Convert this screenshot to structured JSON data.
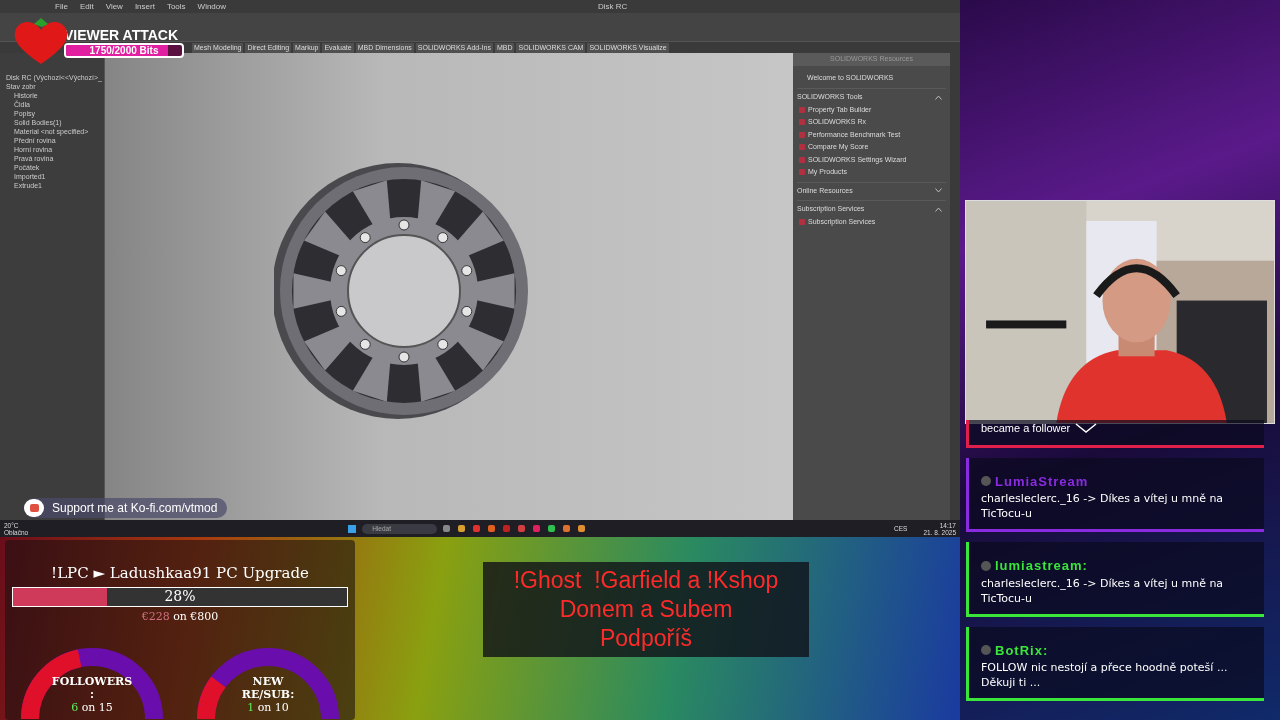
{
  "cad_window": {
    "title": "Disk RC",
    "menu": [
      "File",
      "Edit",
      "View",
      "Insert",
      "Tools",
      "Window"
    ],
    "tabs": [
      "Mesh Modeling",
      "Direct Editing",
      "Markup",
      "Evaluate",
      "MBD Dimensions",
      "SOLIDWORKS Add-Ins",
      "MBD",
      "SOLIDWORKS CAM",
      "SOLIDWORKS Visualize"
    ],
    "tree": [
      {
        "label": "Disk RC (Výchozí<<Výchozí>_Stav zobr"
      },
      {
        "label": "Historie"
      },
      {
        "label": "Čidla"
      },
      {
        "label": "Popisy"
      },
      {
        "label": "Solid Bodies(1)"
      },
      {
        "label": "Material <not specified>"
      },
      {
        "label": "Přední rovina"
      },
      {
        "label": "Horní rovina"
      },
      {
        "label": "Pravá rovina"
      },
      {
        "label": "Počátek"
      },
      {
        "label": "Imported1"
      },
      {
        "label": "Extrude1"
      }
    ],
    "task_pane": {
      "title": "SOLIDWORKS Resources",
      "welcome": "Welcome to SOLIDWORKS",
      "sections": [
        {
          "title": "SOLIDWORKS Tools",
          "expanded": true,
          "items": [
            "Property Tab Builder",
            "SOLIDWORKS Rx",
            "Performance Benchmark Test",
            "Compare My Score",
            "SOLIDWORKS Settings Wizard",
            "My Products"
          ]
        },
        {
          "title": "Online Resources",
          "expanded": false
        },
        {
          "title": "Subscription Services",
          "expanded": true,
          "items": [
            "Subscription Services"
          ]
        }
      ]
    }
  },
  "taskbar": {
    "weather_temp": "20°C",
    "weather_text": "Oblačno",
    "search_placeholder": "Hledat",
    "language": "CES",
    "time": "14:17",
    "date": "21. 8. 2025"
  },
  "viewer_attack": {
    "title": "VIEWER ATTACK",
    "progress": "1750/2000 Bits",
    "level": 0.875
  },
  "kofi": {
    "text": "Support me at Ko-fi.com/vtmod"
  },
  "goal": {
    "title": "!LPC ► Ladushkaa91 PC Upgrade",
    "level": 0.28,
    "reading": "28%",
    "raised": "€228",
    "target": "on €800"
  },
  "gauges": [
    {
      "label_lines": [
        "FOLLOWERS",
        ":"
      ],
      "count": "6",
      "target": "on 15",
      "level": 0.4
    },
    {
      "label_lines": [
        "NEW",
        "RE/SUB:"
      ],
      "count": "1",
      "target": "on 10",
      "level": 0.1
    }
  ],
  "commands": {
    "lines": [
      "!Ghost  !Garfield a !Kshop",
      "Donem a Subem",
      "Podpoříš"
    ]
  },
  "chat": [
    {
      "kind": "event",
      "text": "became a follower",
      "color": "#e0204a"
    },
    {
      "kind": "message",
      "name": "LumiaStream",
      "text": "charlesleclerc._16 -> Díkes a vítej u mně na TicTocu-u",
      "color": "#8a2be2"
    },
    {
      "kind": "message",
      "name": "lumiastream:",
      "text": "charlesleclerc._16 -> Díkes a vítej u mně na TicTocu-u",
      "color": "#39e639"
    },
    {
      "kind": "message",
      "name": "BotRix:",
      "text": "FOLLOW nic nestojí a přece hoodně poteší ... Děkuji ti ...",
      "color": "#39e639"
    }
  ]
}
